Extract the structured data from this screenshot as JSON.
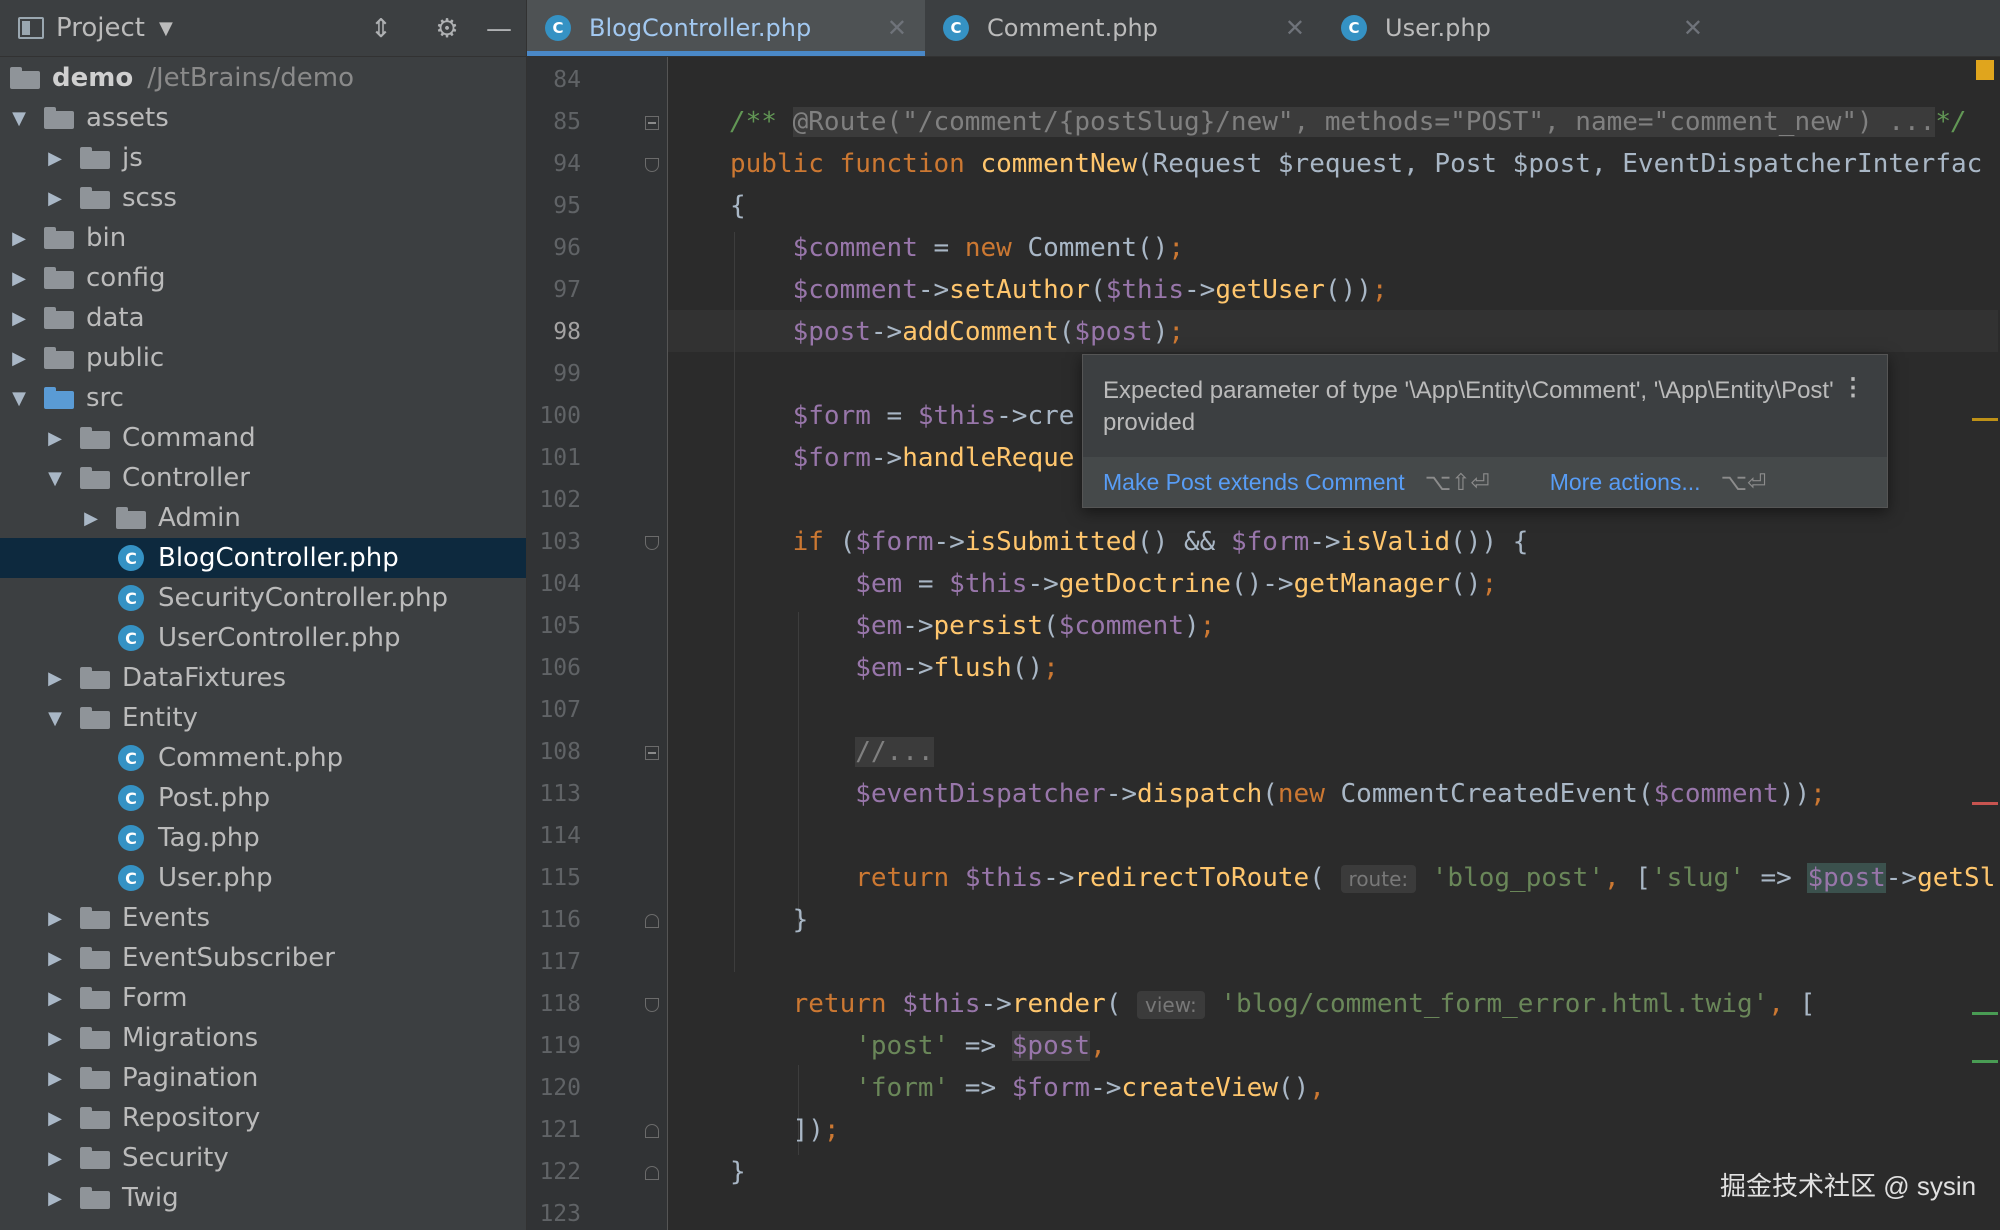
{
  "sidebar": {
    "title": "Project",
    "root": {
      "name": "demo",
      "path": "/JetBrains/demo"
    },
    "items": [
      {
        "label": "assets"
      },
      {
        "label": "js"
      },
      {
        "label": "scss"
      },
      {
        "label": "bin"
      },
      {
        "label": "config"
      },
      {
        "label": "data"
      },
      {
        "label": "public"
      },
      {
        "label": "src"
      },
      {
        "label": "Command"
      },
      {
        "label": "Controller"
      },
      {
        "label": "Admin"
      },
      {
        "label": "BlogController.php"
      },
      {
        "label": "SecurityController.php"
      },
      {
        "label": "UserController.php"
      },
      {
        "label": "DataFixtures"
      },
      {
        "label": "Entity"
      },
      {
        "label": "Comment.php"
      },
      {
        "label": "Post.php"
      },
      {
        "label": "Tag.php"
      },
      {
        "label": "User.php"
      },
      {
        "label": "Events"
      },
      {
        "label": "EventSubscriber"
      },
      {
        "label": "Form"
      },
      {
        "label": "Migrations"
      },
      {
        "label": "Pagination"
      },
      {
        "label": "Repository"
      },
      {
        "label": "Security"
      },
      {
        "label": "Twig"
      }
    ]
  },
  "tabs": [
    {
      "label": "BlogController.php",
      "icon": "C"
    },
    {
      "label": "Comment.php",
      "icon": "C"
    },
    {
      "label": "User.php",
      "icon": "C"
    }
  ],
  "gutter": {
    "line_numbers": [
      "84",
      "85",
      "94",
      "95",
      "96",
      "97",
      "98",
      "99",
      "100",
      "101",
      "102",
      "103",
      "104",
      "105",
      "106",
      "107",
      "108",
      "113",
      "114",
      "115",
      "116",
      "117",
      "118",
      "119",
      "120",
      "121",
      "122",
      "123"
    ]
  },
  "code": {
    "l85": "@Route(\"/comment/{postSlug}/new\", methods=\"POST\", name=\"comment_new\") ...",
    "l94_fn": "commentNew",
    "l94_rest": "Request $request, Post $post, EventDispatcherInterfac",
    "l98_method": "addComment",
    "hint_route": "route:",
    "hint_view": "view:",
    "str_blog_post": "'blog_post'",
    "str_slug": "'slug'",
    "str_template": "'blog/comment_form_error.html.twig'",
    "str_post": "'post'",
    "str_form": "'form'"
  },
  "popup": {
    "message": "Expected parameter of type '\\App\\Entity\\Comment', '\\App\\Entity\\Post' provided",
    "action1": "Make Post extends Comment",
    "action1_shortcut": "⌥⇧⏎",
    "action2": "More actions...",
    "action2_shortcut": "⌥⏎"
  },
  "watermark": "掘金技术社区 @ sysin",
  "colors": {
    "editor_bg": "#2b2b2b",
    "sidebar_bg": "#3c3f41",
    "selection": "#0d293e",
    "accent": "#4a88c7",
    "keyword": "#cc7832",
    "variable": "#9876aa",
    "function": "#ffc66d",
    "string": "#6a8759",
    "link": "#589df6"
  }
}
